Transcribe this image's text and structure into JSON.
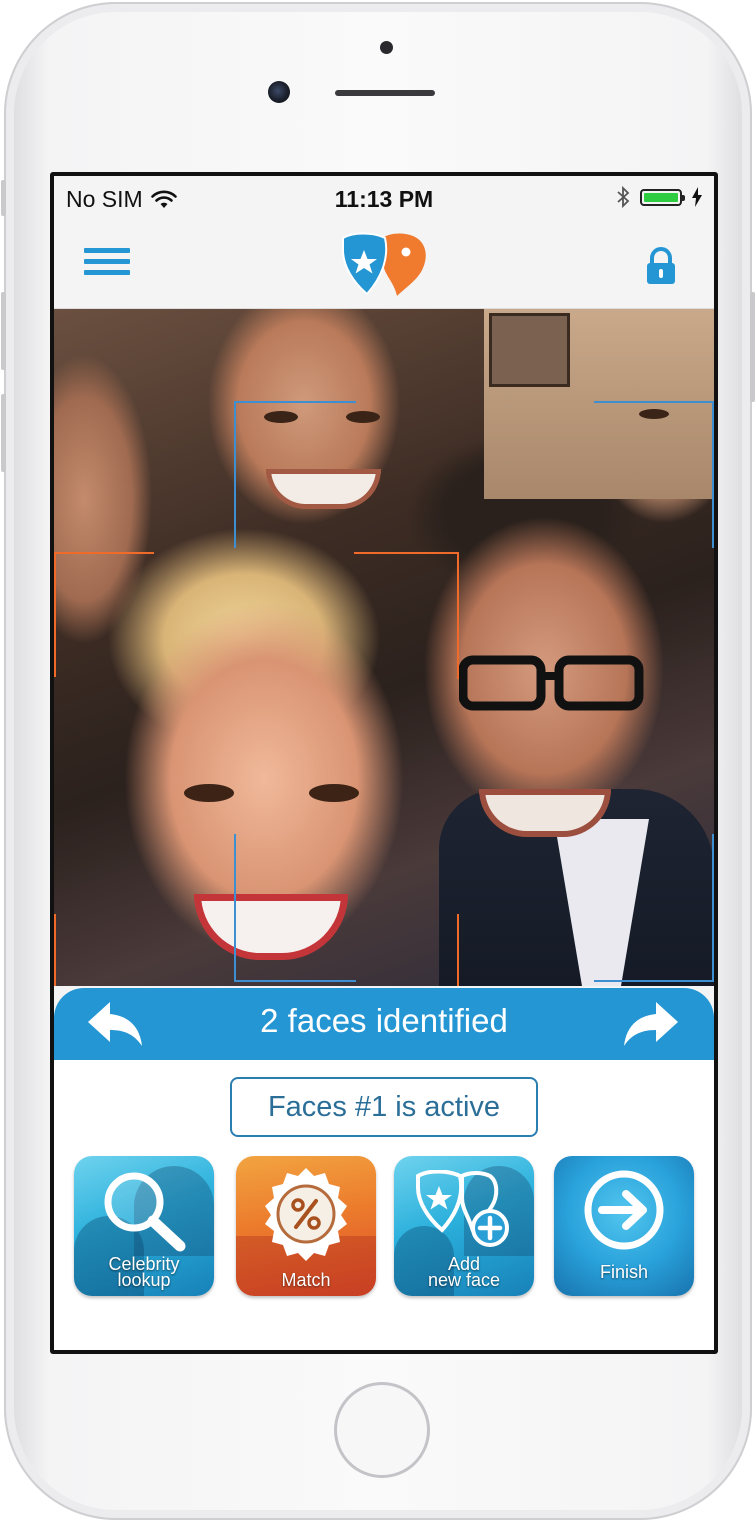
{
  "status_bar": {
    "carrier": "No SIM",
    "time": "11:13 PM",
    "battery_level": 1.0,
    "icons": [
      "wifi-icon",
      "bluetooth-icon",
      "battery-icon",
      "charging-bolt-icon"
    ]
  },
  "navbar": {
    "menu_icon": "hamburger-icon",
    "logo": "app-logo",
    "lock_icon": "lock-icon"
  },
  "photo": {
    "subject": "group-selfie",
    "detection_boxes": [
      "face-box-1",
      "face-box-2"
    ]
  },
  "banner": {
    "text": "2 faces identified",
    "prev_icon": "undo-arrow-icon",
    "next_icon": "redo-arrow-icon"
  },
  "active_face": {
    "text": "Faces #1 is active"
  },
  "actions": [
    {
      "label_line1": "Celebrity",
      "label_line2": "lookup",
      "icon": "magnifier-icon"
    },
    {
      "label_line1": "Match",
      "label_line2": "",
      "icon": "percent-badge-icon"
    },
    {
      "label_line1": "Add",
      "label_line2": "new face",
      "icon": "add-face-icon"
    },
    {
      "label_line1": "Finish",
      "label_line2": "",
      "icon": "arrow-right-circle-icon"
    }
  ],
  "colors": {
    "accent_blue": "#2596d4",
    "accent_orange": "#f07a2e",
    "box_blue": "#3d8fd1",
    "box_orange": "#f06a2a"
  }
}
